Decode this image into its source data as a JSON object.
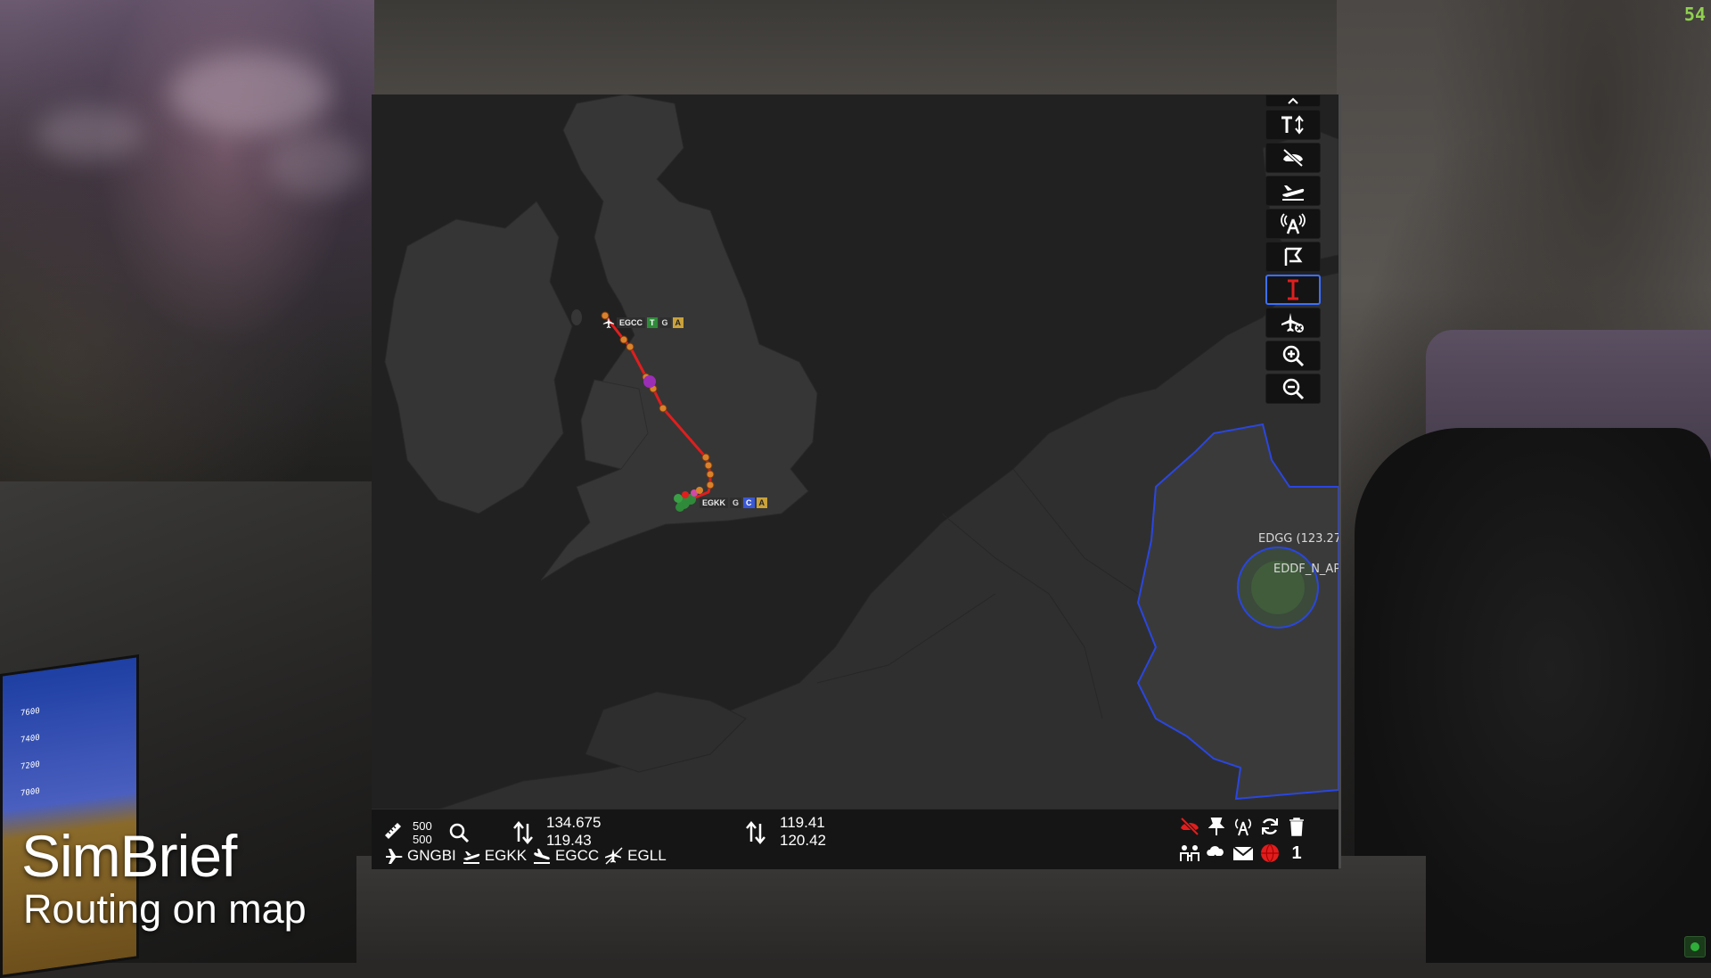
{
  "fps": "54",
  "caption": {
    "title": "SimBrief",
    "subtitle": "Routing on map"
  },
  "colors": {
    "route": "#e01e1e",
    "waypoint": "#d9822b",
    "fir_border": "#2a46e0",
    "active_tool_border": "#3d6fff"
  },
  "toolbar": {
    "items": [
      {
        "name": "collapse-toolbar-button",
        "icon": "chevron-up-icon"
      },
      {
        "name": "text-size-button",
        "icon": "text-size-icon"
      },
      {
        "name": "hide-traffic-button",
        "icon": "traffic-off-icon"
      },
      {
        "name": "airport-departures-button",
        "icon": "plane-departure-icon"
      },
      {
        "name": "atc-stations-button",
        "icon": "atc-tower-icon"
      },
      {
        "name": "flight-plan-button",
        "icon": "route-flag-icon"
      },
      {
        "name": "text-cursor-tool-button",
        "icon": "text-cursor-icon",
        "active": true
      },
      {
        "name": "remove-aircraft-button",
        "icon": "plane-remove-icon"
      },
      {
        "name": "zoom-in-button",
        "icon": "zoom-in-icon"
      },
      {
        "name": "zoom-out-button",
        "icon": "zoom-out-icon"
      }
    ]
  },
  "map": {
    "departure": {
      "code": "EGCC",
      "badges": [
        "T",
        "G",
        "A"
      ]
    },
    "arrival": {
      "code": "EGKK",
      "badges": [
        "G",
        "C",
        "A"
      ]
    },
    "fir_labels": [
      "EDGG (123.27",
      "EDDF_N_AP"
    ]
  },
  "status": {
    "range_top": "500",
    "range_bottom": "500",
    "com1_active": "134.675",
    "com1_standby": "119.43",
    "com2_active": "119.41",
    "com2_standby": "120.42",
    "callsign": "GNGBI",
    "origin": "EGKK",
    "destination": "EGCC",
    "alternate": "EGLL",
    "message_count": "1"
  }
}
